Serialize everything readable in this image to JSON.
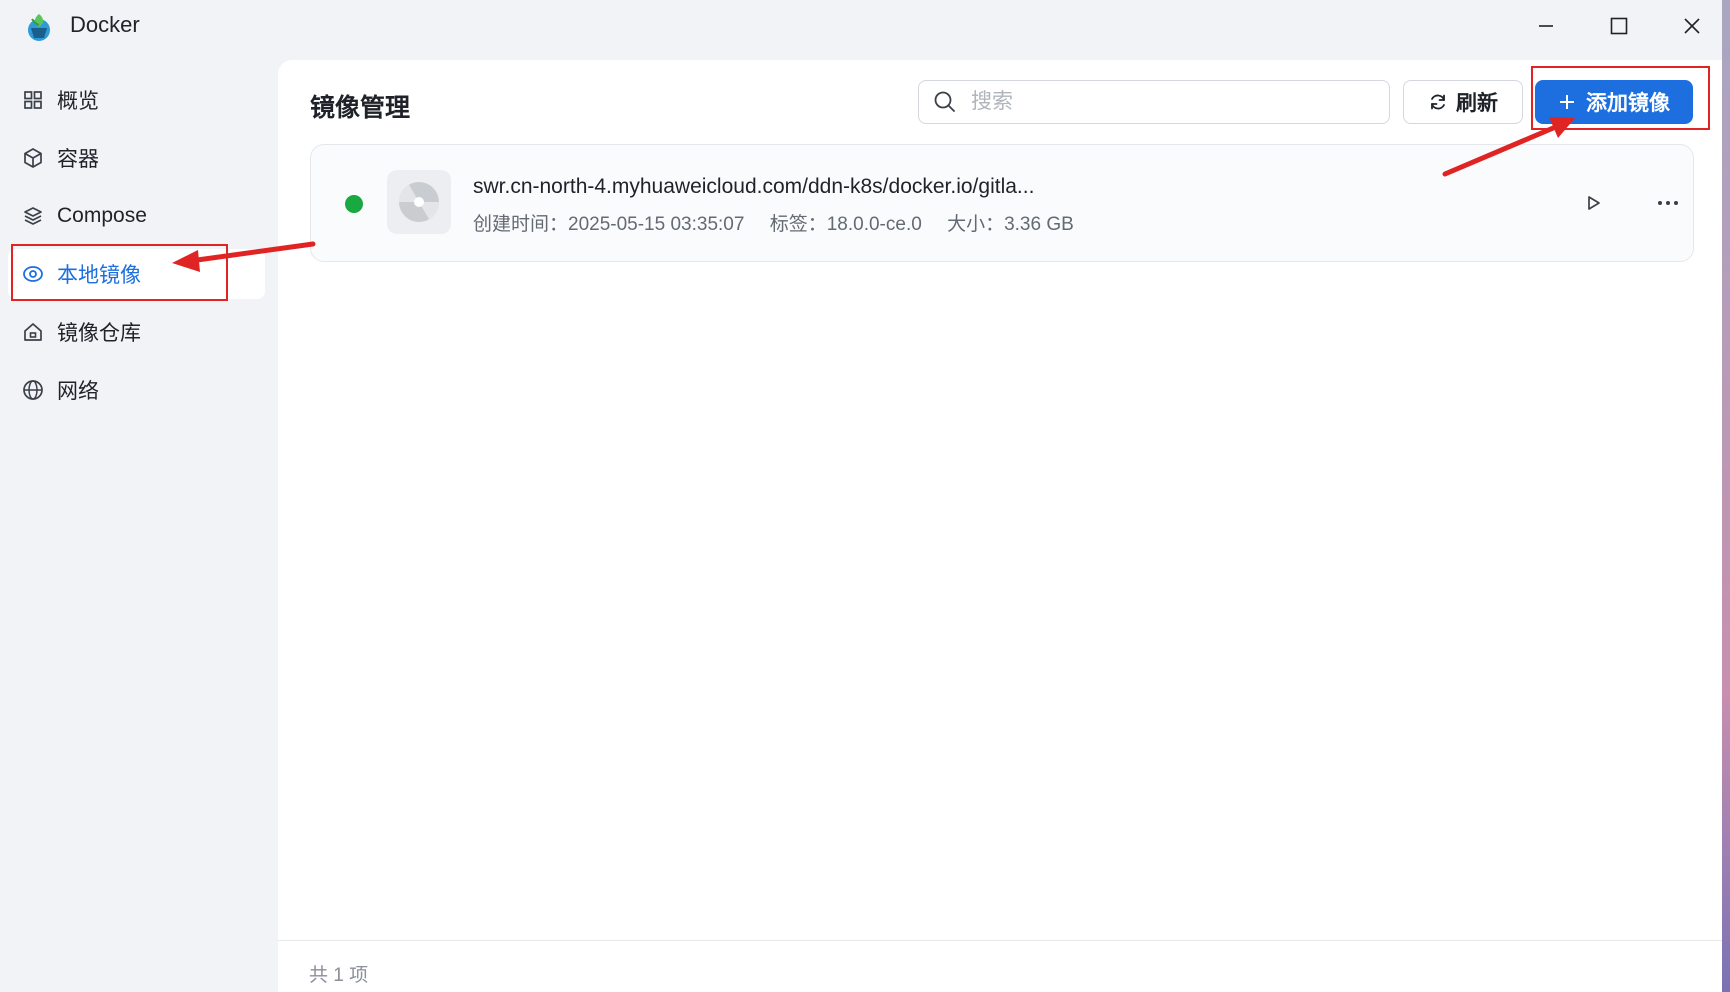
{
  "window": {
    "title": "Docker",
    "controls": [
      "minimize-icon",
      "maximize-icon",
      "close-icon"
    ]
  },
  "sidebar": {
    "items": [
      {
        "label": "概览",
        "icon": "grid-icon"
      },
      {
        "label": "容器",
        "icon": "box-icon"
      },
      {
        "label": "Compose",
        "icon": "layers-icon"
      },
      {
        "label": "本地镜像",
        "icon": "disc-icon",
        "active": true
      },
      {
        "label": "镜像仓库",
        "icon": "house-icon"
      },
      {
        "label": "网络",
        "icon": "globe-icon"
      }
    ]
  },
  "main": {
    "title": "镜像管理",
    "search": {
      "placeholder": "搜索",
      "value": ""
    },
    "refresh_label": "刷新",
    "add_label": "添加镜像",
    "images": [
      {
        "name": "swr.cn-north-4.myhuaweicloud.com/ddn-k8s/docker.io/gitla...",
        "created": "创建时间：2025-05-15 03:35:07",
        "tag": "标签：18.0.0-ce.0",
        "size": "大小：3.36 GB",
        "status_color": "#19a842"
      }
    ],
    "footer_count": "共 1 项"
  },
  "colors": {
    "accent": "#1d6fe0",
    "annotation": "#e02424",
    "status_running": "#19a842"
  }
}
